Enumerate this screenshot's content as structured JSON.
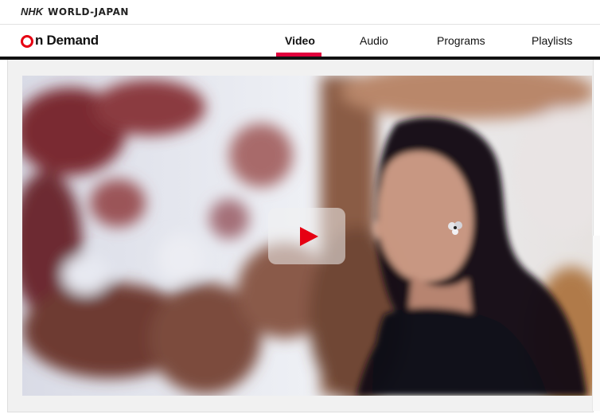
{
  "brand": {
    "nhk": "NHK",
    "world_japan": "WORLD-JAPAN"
  },
  "logo": {
    "rest": "n Demand"
  },
  "nav": {
    "tabs": [
      {
        "label": "Video",
        "active": true
      },
      {
        "label": "Audio",
        "active": false
      },
      {
        "label": "Programs",
        "active": false
      },
      {
        "label": "Playlists",
        "active": false
      }
    ]
  },
  "colors": {
    "accent": "#e0003c",
    "logo_red": "#e60012",
    "text": "#111111"
  },
  "hero": {
    "play_icon": "play-icon"
  }
}
